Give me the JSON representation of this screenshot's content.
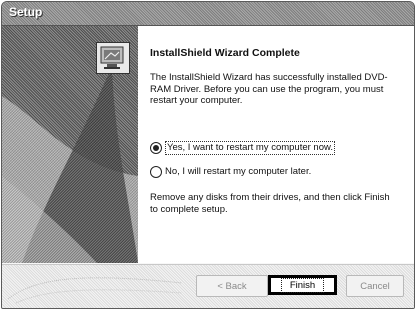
{
  "window": {
    "title": "Setup"
  },
  "wizard": {
    "heading": "InstallShield Wizard Complete",
    "message": "The InstallShield Wizard has successfully installed DVD-RAM Driver.  Before you can use the program, you must restart your computer.",
    "restart_options": [
      {
        "label": "Yes, I want to restart my computer now.",
        "selected": true
      },
      {
        "label": "No, I will restart my computer later.",
        "selected": false
      }
    ],
    "instruction": "Remove any disks from their drives, and then click Finish to complete setup."
  },
  "buttons": {
    "back": "< Back",
    "finish": "Finish",
    "cancel": "Cancel"
  }
}
